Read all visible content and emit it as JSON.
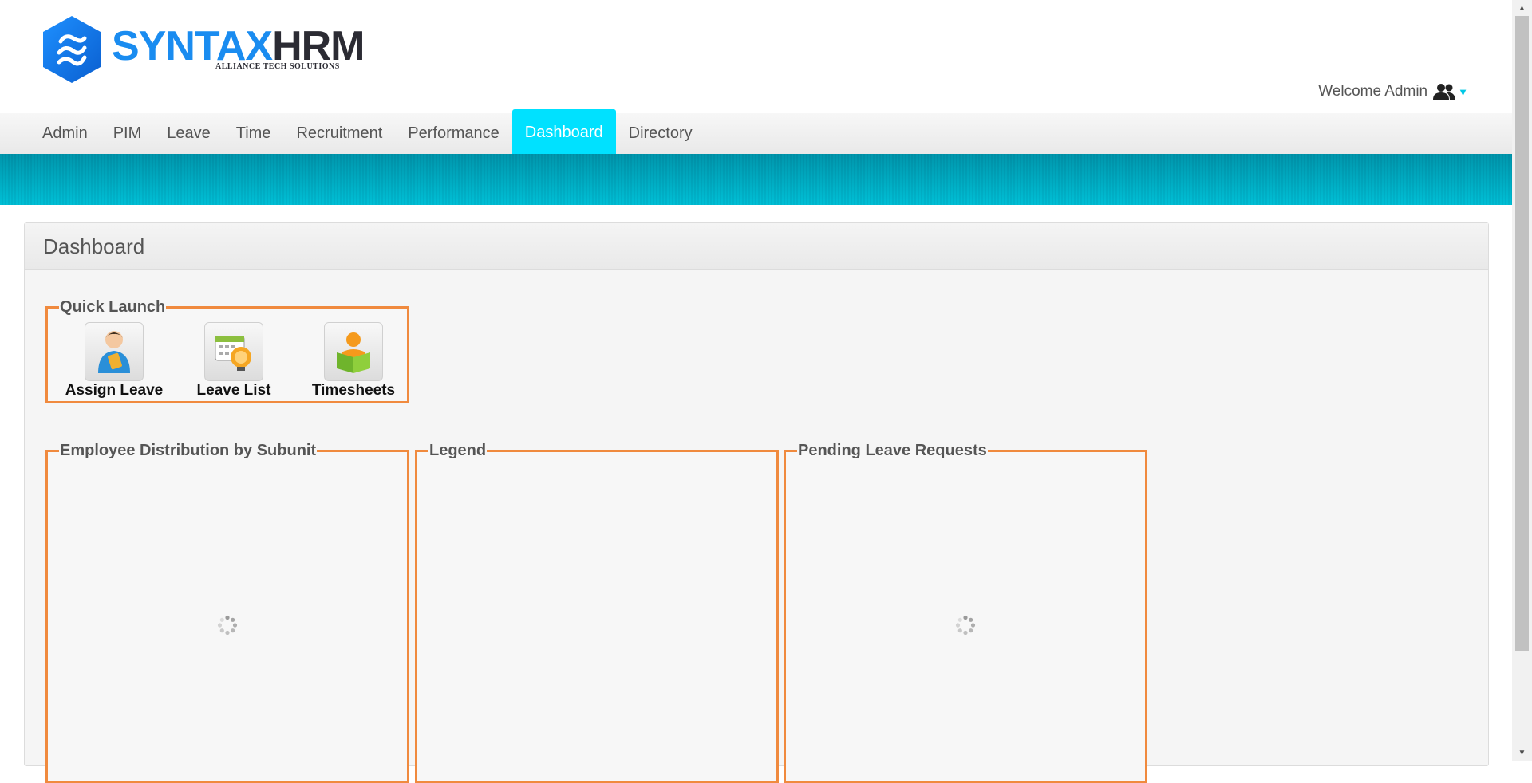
{
  "header": {
    "logo": {
      "brand_part1": "SYNTAX",
      "brand_part2": "HRM",
      "tagline": "ALLIANCE TECH SOLUTIONS"
    },
    "welcome_text": "Welcome Admin",
    "user_icon": "users-icon"
  },
  "nav": {
    "items": [
      {
        "label": "Admin"
      },
      {
        "label": "PIM"
      },
      {
        "label": "Leave"
      },
      {
        "label": "Time"
      },
      {
        "label": "Recruitment"
      },
      {
        "label": "Performance"
      },
      {
        "label": "Dashboard",
        "active": true
      },
      {
        "label": "Directory"
      }
    ]
  },
  "panel": {
    "title": "Dashboard",
    "quick_launch": {
      "title": "Quick Launch",
      "items": [
        {
          "label": "Assign Leave",
          "icon": "assign-leave-icon"
        },
        {
          "label": "Leave List",
          "icon": "leave-list-icon"
        },
        {
          "label": "Timesheets",
          "icon": "timesheets-icon"
        }
      ]
    },
    "widgets": [
      {
        "title": "Employee Distribution by Subunit",
        "loading": true
      },
      {
        "title": "Legend",
        "loading": false
      },
      {
        "title": "Pending Leave Requests",
        "loading": true
      }
    ]
  },
  "colors": {
    "accent": "#00e1ff",
    "banner": "#00b5cc",
    "widget_border": "#f08a3e",
    "logo_blue": "#1a8cf0"
  }
}
